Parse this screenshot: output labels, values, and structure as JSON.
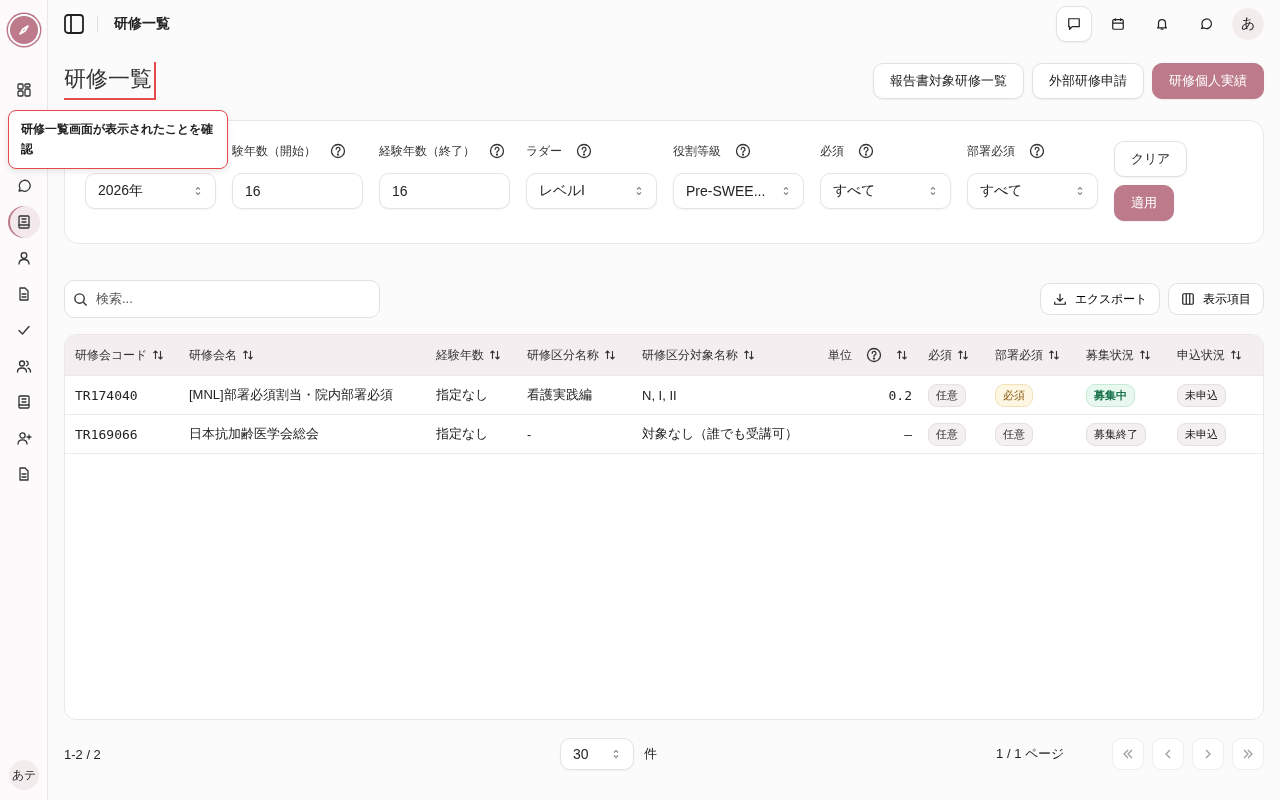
{
  "sidebar": {
    "items": [
      {
        "kind": "grid",
        "selected": false
      },
      {
        "kind": "chat",
        "selected": false
      },
      {
        "kind": "book",
        "selected": true
      },
      {
        "kind": "person",
        "selected": false
      },
      {
        "kind": "document",
        "selected": false
      },
      {
        "kind": "check",
        "selected": false
      },
      {
        "kind": "people",
        "selected": false
      },
      {
        "kind": "book",
        "selected": false
      },
      {
        "kind": "person-add",
        "selected": false
      },
      {
        "kind": "document",
        "selected": false
      }
    ],
    "user_avatar": "あテ"
  },
  "header": {
    "breadcrumb": "研修一覧",
    "avatar": "あ"
  },
  "page_title": "研修一覧",
  "tooltip": "研修一覧画面が表示されたことを確認",
  "actions": [
    {
      "label": "報告書対象研修一覧",
      "primary": false
    },
    {
      "label": "外部研修申請",
      "primary": false
    },
    {
      "label": "研修個人実績",
      "primary": true
    }
  ],
  "filters": [
    {
      "kind": "select",
      "value": "2026年"
    },
    {
      "kind": "input",
      "label": "験年数（開始）",
      "value": "16"
    },
    {
      "kind": "input",
      "label": "経験年数（終了）",
      "value": "16"
    },
    {
      "kind": "select",
      "label": "ラダー",
      "value": "レベルI"
    },
    {
      "kind": "select",
      "label": "役割等級",
      "value": "Pre-SWEE..."
    },
    {
      "kind": "select",
      "label": "必須",
      "value": "すべて"
    },
    {
      "kind": "select",
      "label": "部署必須",
      "value": "すべて"
    }
  ],
  "filter_buttons": {
    "clear": "クリア",
    "apply": "適用"
  },
  "search": {
    "placeholder": "検索..."
  },
  "toolbar": {
    "export": "エクスポート",
    "columns": "表示項目"
  },
  "table": {
    "columns": [
      {
        "label": "研修会コード",
        "help": false
      },
      {
        "label": "研修会名",
        "help": false
      },
      {
        "label": "経験年数",
        "help": false
      },
      {
        "label": "研修区分名称",
        "help": false
      },
      {
        "label": "研修区分対象名称",
        "help": false
      },
      {
        "label": "単位",
        "help": true
      },
      {
        "label": "必須",
        "help": false
      },
      {
        "label": "部署必須",
        "help": false
      },
      {
        "label": "募集状況",
        "help": false
      },
      {
        "label": "申込状況",
        "help": false
      }
    ],
    "rows": [
      {
        "code": "TR174040",
        "name": "[MNL]部署必須割当・院内部署必須",
        "years": "指定なし",
        "division": "看護実践編",
        "target": "N, I, II",
        "unit": "0.2",
        "badges": [
          {
            "text": "任意",
            "kind": "neutral"
          },
          {
            "text": "必須",
            "kind": "warning"
          },
          {
            "text": "募集中",
            "kind": "success"
          },
          {
            "text": "未申込",
            "kind": "neutral"
          }
        ]
      },
      {
        "code": "TR169066",
        "name": "日本抗加齢医学会総会",
        "years": "指定なし",
        "division": "-",
        "target": "対象なし（誰でも受講可）",
        "unit": "–",
        "badges": [
          {
            "text": "任意",
            "kind": "neutral"
          },
          {
            "text": "任意",
            "kind": "neutral"
          },
          {
            "text": "募集終了",
            "kind": "neutral"
          },
          {
            "text": "未申込",
            "kind": "neutral"
          }
        ]
      }
    ]
  },
  "footer": {
    "range": "1-2 / 2",
    "page_size": "30",
    "unit": "件",
    "page": "1 / 1 ページ"
  }
}
